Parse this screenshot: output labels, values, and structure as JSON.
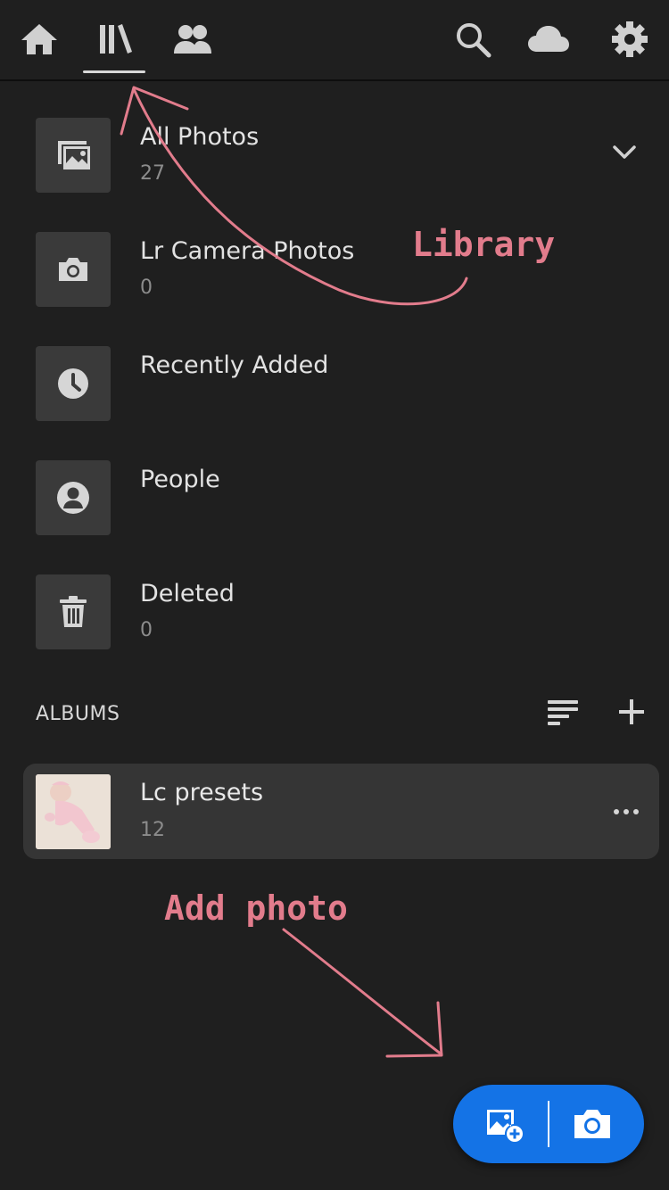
{
  "nav": {
    "tabs": [
      {
        "name": "home",
        "icon": "home-icon"
      },
      {
        "name": "library",
        "icon": "library-icon",
        "active": true
      },
      {
        "name": "people",
        "icon": "people-icon"
      }
    ],
    "actions": [
      {
        "name": "search",
        "icon": "search-icon"
      },
      {
        "name": "cloud",
        "icon": "cloud-icon"
      },
      {
        "name": "settings",
        "icon": "gear-icon"
      }
    ]
  },
  "library": {
    "items": [
      {
        "title": "All Photos",
        "count": "27",
        "icon": "image-stack-icon"
      },
      {
        "title": "Lr Camera Photos",
        "count": "0",
        "icon": "camera-icon"
      },
      {
        "title": "Recently Added",
        "count": "",
        "icon": "clock-icon"
      },
      {
        "title": "People",
        "count": "",
        "icon": "person-icon"
      },
      {
        "title": "Deleted",
        "count": "0",
        "icon": "trash-icon"
      }
    ]
  },
  "albums": {
    "header": "ALBUMS",
    "items": [
      {
        "title": "Lc presets",
        "count": "12",
        "more": "•••"
      }
    ]
  },
  "annotations": {
    "library": "Library",
    "add_photo": "Add photo",
    "color": "#e27c8c"
  },
  "fab": {
    "accent": "#1473e6",
    "left_icon": "add-image-icon",
    "right_icon": "camera-icon"
  }
}
